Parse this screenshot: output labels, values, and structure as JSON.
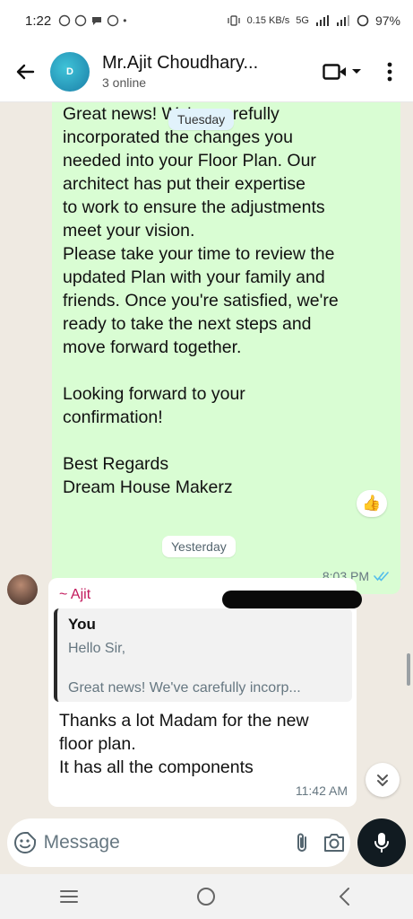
{
  "status_bar": {
    "time": "1:22",
    "network": "5G",
    "speed": "0.15 KB/s",
    "battery": "97%"
  },
  "header": {
    "contact_name": "Mr.Ajit Choudhary...",
    "status": "3 online",
    "avatar_text": "D"
  },
  "chat": {
    "floating_date": "Tuesday",
    "outgoing": {
      "text": "Great news! We've carefully\nincorporated the changes you\nneeded into your Floor Plan. Our\narchitect has put their expertise\nto work to ensure the adjustments\nmeet your vision.\nPlease take your time to review the\nupdated Plan with your family and\nfriends. Once you're satisfied, we're\nready to take the next steps and\nmove forward together.\n\nLooking forward to your\nconfirmation!\n\nBest Regards\nDream House Makerz",
      "time": "8:03 PM",
      "reaction": "👍"
    },
    "date_separator": "Yesterday",
    "incoming": {
      "sender": "~ Ajit",
      "quote_author": "You",
      "quote_line1": "Hello Sir,",
      "quote_line2": "Great news! We've carefully incorp...",
      "text": "Thanks a lot Madam for the new\nfloor plan.\nIt has all the components",
      "time": "11:42 AM"
    }
  },
  "composer": {
    "placeholder": "Message"
  },
  "colors": {
    "outgoing_bubble": "#d9fdd3",
    "chat_background": "#efeae2",
    "sender_name": "#c2185b",
    "read_ticks": "#53bdeb"
  }
}
